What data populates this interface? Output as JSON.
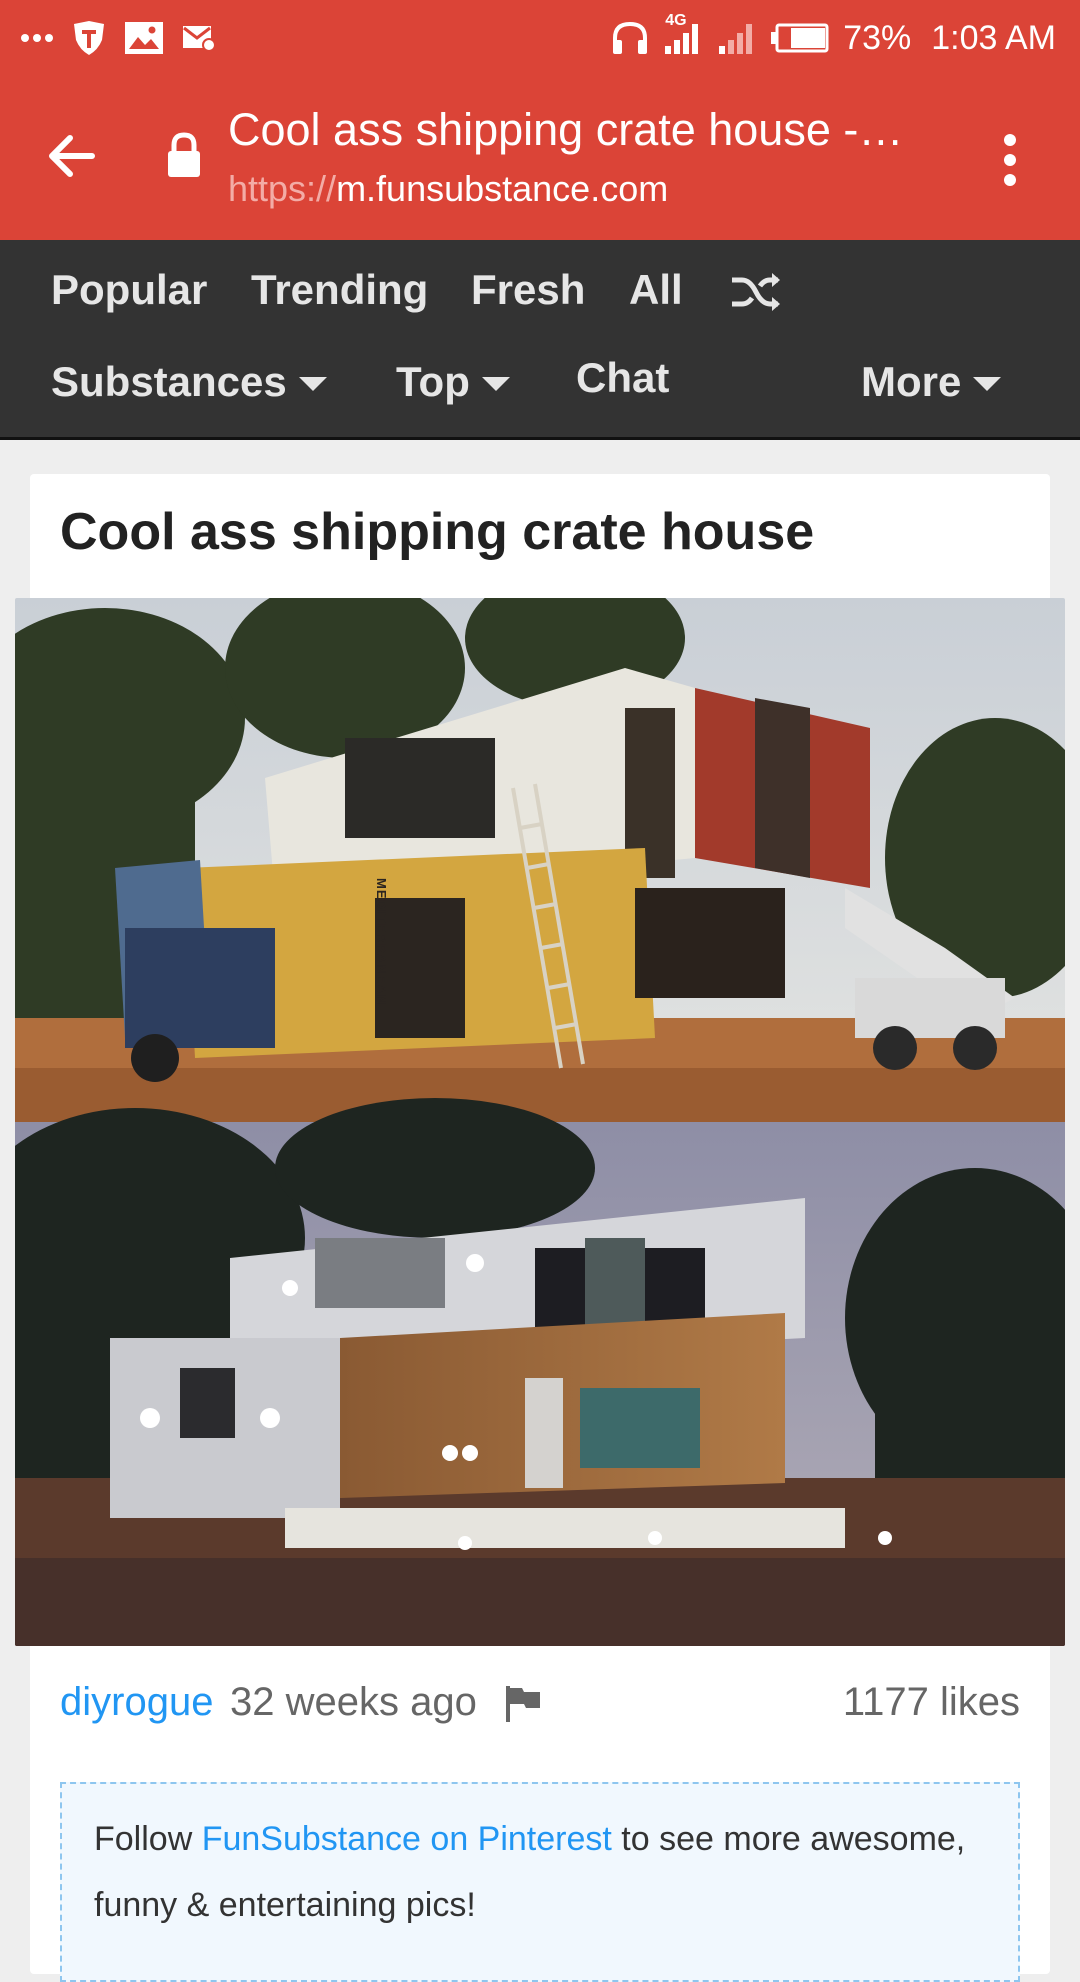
{
  "status_bar": {
    "network": "4G",
    "battery": "73%",
    "time": "1:03 AM"
  },
  "toolbar": {
    "page_title": "Cool ass shipping crate house -…",
    "url_scheme": "https://",
    "url_host": "m.funsubstance.com"
  },
  "nav": {
    "row1": [
      "Popular",
      "Trending",
      "Fresh",
      "All"
    ],
    "substances": "Substances",
    "top": "Top",
    "chat": "Chat",
    "more": "More"
  },
  "post": {
    "title": "Cool ass shipping crate house",
    "author": "diyrogue",
    "time_ago": "32 weeks ago",
    "likes": "1177 likes",
    "image_text": "MEDITERRANEAN"
  },
  "follow": {
    "prefix": "Follow ",
    "link": "FunSubstance on Pinterest",
    "suffix": " to see more awesome, funny & entertaining pics!"
  },
  "colors": {
    "brand_red": "#db4437",
    "nav_dark": "#333333",
    "link_blue": "#2196f3"
  }
}
